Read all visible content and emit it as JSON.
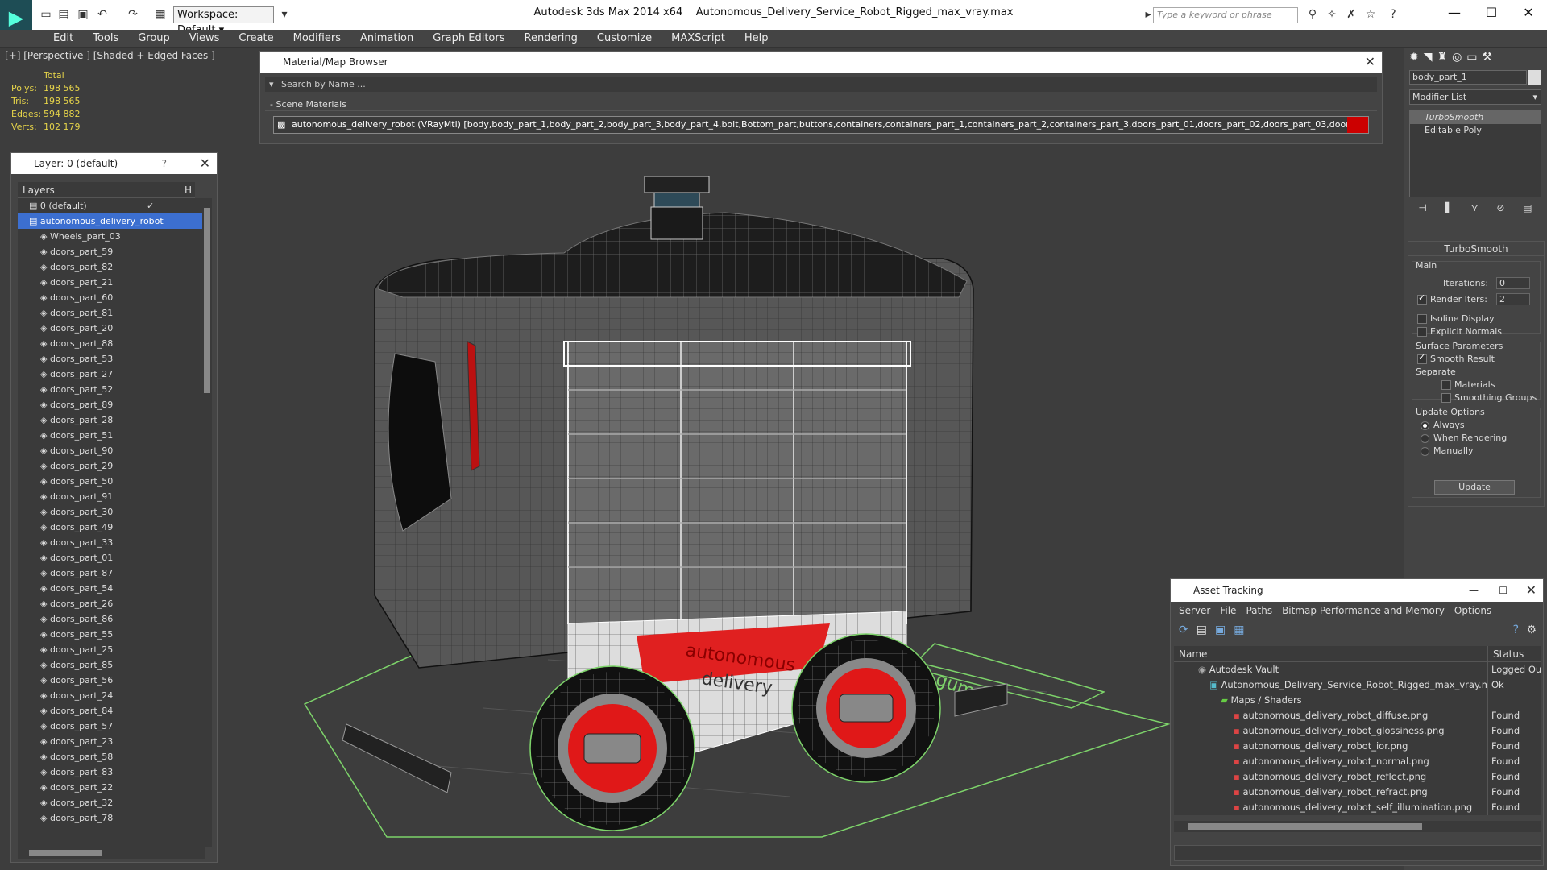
{
  "app": {
    "title": "Autodesk 3ds Max  2014 x64",
    "file": "Autonomous_Delivery_Service_Robot_Rigged_max_vray.max",
    "workspace": "Workspace: Default",
    "search_placeholder": "Type a keyword or phrase"
  },
  "menu": [
    "Edit",
    "Tools",
    "Group",
    "Views",
    "Create",
    "Modifiers",
    "Animation",
    "Graph Editors",
    "Rendering",
    "Customize",
    "MAXScript",
    "Help"
  ],
  "viewport": {
    "label": "[+] [Perspective ] [Shaded + Edged Faces ]",
    "stats_header": "Total",
    "stats": [
      {
        "k": "Polys:",
        "v": "198 565"
      },
      {
        "k": "Tris:",
        "v": "198 565"
      },
      {
        "k": "Edges:",
        "v": "594 882"
      },
      {
        "k": "Verts:",
        "v": "102 179"
      }
    ],
    "wheel_text_1": "autonomous",
    "wheel_text_2": "delivery",
    "ground_text": "gum"
  },
  "layer_panel": {
    "title": "Layer: 0 (default)",
    "help": "?",
    "header": "Layers",
    "header_right": "H",
    "rows": [
      {
        "label": "0 (default)",
        "indent": 1,
        "selected": false
      },
      {
        "label": "autonomous_delivery_robot",
        "indent": 1,
        "selected": true
      },
      {
        "label": "Wheels_part_03",
        "indent": 2
      },
      {
        "label": "doors_part_59",
        "indent": 2
      },
      {
        "label": "doors_part_82",
        "indent": 2
      },
      {
        "label": "doors_part_21",
        "indent": 2
      },
      {
        "label": "doors_part_60",
        "indent": 2
      },
      {
        "label": "doors_part_81",
        "indent": 2
      },
      {
        "label": "doors_part_20",
        "indent": 2
      },
      {
        "label": "doors_part_88",
        "indent": 2
      },
      {
        "label": "doors_part_53",
        "indent": 2
      },
      {
        "label": "doors_part_27",
        "indent": 2
      },
      {
        "label": "doors_part_52",
        "indent": 2
      },
      {
        "label": "doors_part_89",
        "indent": 2
      },
      {
        "label": "doors_part_28",
        "indent": 2
      },
      {
        "label": "doors_part_51",
        "indent": 2
      },
      {
        "label": "doors_part_90",
        "indent": 2
      },
      {
        "label": "doors_part_29",
        "indent": 2
      },
      {
        "label": "doors_part_50",
        "indent": 2
      },
      {
        "label": "doors_part_91",
        "indent": 2
      },
      {
        "label": "doors_part_30",
        "indent": 2
      },
      {
        "label": "doors_part_49",
        "indent": 2
      },
      {
        "label": "doors_part_33",
        "indent": 2
      },
      {
        "label": "doors_part_01",
        "indent": 2
      },
      {
        "label": "doors_part_87",
        "indent": 2
      },
      {
        "label": "doors_part_54",
        "indent": 2
      },
      {
        "label": "doors_part_26",
        "indent": 2
      },
      {
        "label": "doors_part_86",
        "indent": 2
      },
      {
        "label": "doors_part_55",
        "indent": 2
      },
      {
        "label": "doors_part_25",
        "indent": 2
      },
      {
        "label": "doors_part_85",
        "indent": 2
      },
      {
        "label": "doors_part_56",
        "indent": 2
      },
      {
        "label": "doors_part_24",
        "indent": 2
      },
      {
        "label": "doors_part_84",
        "indent": 2
      },
      {
        "label": "doors_part_57",
        "indent": 2
      },
      {
        "label": "doors_part_23",
        "indent": 2
      },
      {
        "label": "doors_part_58",
        "indent": 2
      },
      {
        "label": "doors_part_83",
        "indent": 2
      },
      {
        "label": "doors_part_22",
        "indent": 2
      },
      {
        "label": "doors_part_32",
        "indent": 2
      },
      {
        "label": "doors_part_78",
        "indent": 2
      }
    ]
  },
  "material_browser": {
    "title": "Material/Map Browser",
    "search_placeholder": "Search by Name ...",
    "section": "Scene Materials",
    "item": "autonomous_delivery_robot (VRayMtl) [body,body_part_1,body_part_2,body_part_3,body_part_4,bolt,Bottom_part,buttons,containers,containers_part_1,containers_part_2,containers_part_3,doors_part_01,doors_part_02,doors_part_03,doors_part_0..."
  },
  "command_panel": {
    "object_name": "body_part_1",
    "modifier_list": "Modifier List",
    "stack": [
      "TurboSmooth",
      "Editable Poly"
    ],
    "turbosmooth": {
      "title": "TurboSmooth",
      "main": "Main",
      "iterations_label": "Iterations:",
      "iterations": "0",
      "render_iters_label": "Render Iters:",
      "render_iters": "2",
      "isoline": "Isoline Display",
      "explicit_normals": "Explicit Normals",
      "surface_params": "Surface Parameters",
      "smooth_result": "Smooth Result",
      "separate": "Separate",
      "materials": "Materials",
      "smoothing_groups": "Smoothing Groups",
      "update_options": "Update Options",
      "always": "Always",
      "when_rendering": "When Rendering",
      "manually": "Manually",
      "update": "Update"
    }
  },
  "asset_tracking": {
    "title": "Asset Tracking",
    "menu": [
      "Server",
      "File",
      "Paths",
      "Bitmap Performance and Memory",
      "Options"
    ],
    "col_name": "Name",
    "col_status": "Status",
    "rows": [
      {
        "name": "Autodesk Vault",
        "status": "Logged Ou",
        "indent": 30,
        "icon": "vault"
      },
      {
        "name": "Autonomous_Delivery_Service_Robot_Rigged_max_vray.max",
        "status": "Ok",
        "indent": 44,
        "icon": "max"
      },
      {
        "name": "Maps / Shaders",
        "status": "",
        "indent": 58,
        "icon": "folder"
      },
      {
        "name": "autonomous_delivery_robot_diffuse.png",
        "status": "Found",
        "indent": 74,
        "icon": "png"
      },
      {
        "name": "autonomous_delivery_robot_glossiness.png",
        "status": "Found",
        "indent": 74,
        "icon": "png"
      },
      {
        "name": "autonomous_delivery_robot_ior.png",
        "status": "Found",
        "indent": 74,
        "icon": "png"
      },
      {
        "name": "autonomous_delivery_robot_normal.png",
        "status": "Found",
        "indent": 74,
        "icon": "png"
      },
      {
        "name": "autonomous_delivery_robot_reflect.png",
        "status": "Found",
        "indent": 74,
        "icon": "png"
      },
      {
        "name": "autonomous_delivery_robot_refract.png",
        "status": "Found",
        "indent": 74,
        "icon": "png"
      },
      {
        "name": "autonomous_delivery_robot_self_illumination.png",
        "status": "Found",
        "indent": 74,
        "icon": "png"
      }
    ]
  }
}
